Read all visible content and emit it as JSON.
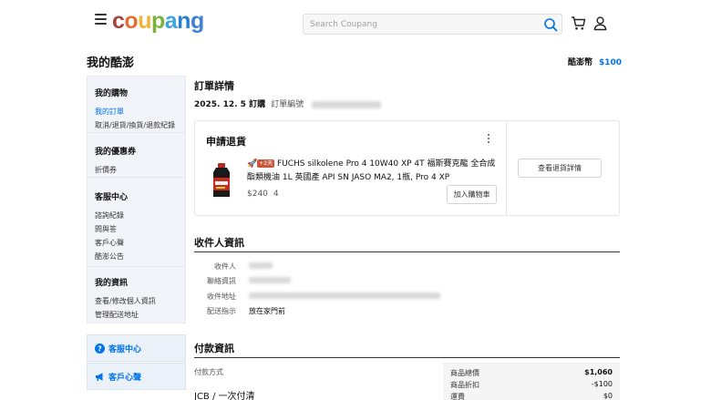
{
  "header": {
    "logo": {
      "c": "c",
      "o": "o",
      "u": "u",
      "p": "p",
      "a": "a",
      "n": "n",
      "g": "g"
    },
    "logo_colors": [
      "#a4453b",
      "#e56e34",
      "#f2b234",
      "#7ab23d",
      "#3aa4e1",
      "#277fd1",
      "#3f82d3"
    ],
    "search_placeholder": "Search Coupang",
    "accent": "#0073e9"
  },
  "page": {
    "title": "我的酷澎",
    "cash_label": "酷澎幣",
    "cash_amount": "$100"
  },
  "sidebar": {
    "sections": [
      {
        "title": "我的購物",
        "items": [
          "我的訂單",
          "取消/退貨/換貨/退款紀錄"
        ]
      },
      {
        "title": "我的優惠券",
        "items": [
          "折價券"
        ]
      },
      {
        "title": "客服中心",
        "items": [
          "諮詢紀錄",
          "問與答",
          "客戶心聲",
          "酷澎公告"
        ]
      },
      {
        "title": "我的資訊",
        "items": [
          "查看/修改個人資訊",
          "管理配送地址"
        ]
      }
    ],
    "help": [
      {
        "label": "客服中心",
        "icon": "question-circle-icon"
      },
      {
        "label": "客戶心聲",
        "icon": "megaphone-icon"
      }
    ]
  },
  "order": {
    "section_title": "訂單詳情",
    "date": "2025. 12. 5 訂購",
    "number_label": "訂單編號"
  },
  "return_card": {
    "title": "申請退貨",
    "rocket_badge": "🚀",
    "delivery_tag": "+2天",
    "product_name": "FUCHS silkolene Pro 4 10W40 XP 4T 福斯賽克龍 全合成酯類機油 1L 英國產 API SN JASO MA2, 1瓶, Pro 4 XP",
    "price": "$240",
    "quantity": "4",
    "add_to_cart_label": "加入購物車",
    "view_return_label": "查看退貨詳情"
  },
  "receiver": {
    "section_title": "收件人資訊",
    "fields": [
      {
        "label": "收件人"
      },
      {
        "label": "聯絡資訊"
      },
      {
        "label": "收件地址"
      },
      {
        "label": "配送指示",
        "value": "放在家門前"
      }
    ]
  },
  "payment": {
    "section_title": "付款資訊",
    "method_label": "付款方式",
    "method_value": "JCB / 一次付清",
    "summary": [
      {
        "label": "商品總價",
        "value": "$1,060"
      },
      {
        "label": "商品折扣",
        "value": "-$100"
      },
      {
        "label": "運費",
        "value": "$0"
      }
    ]
  }
}
